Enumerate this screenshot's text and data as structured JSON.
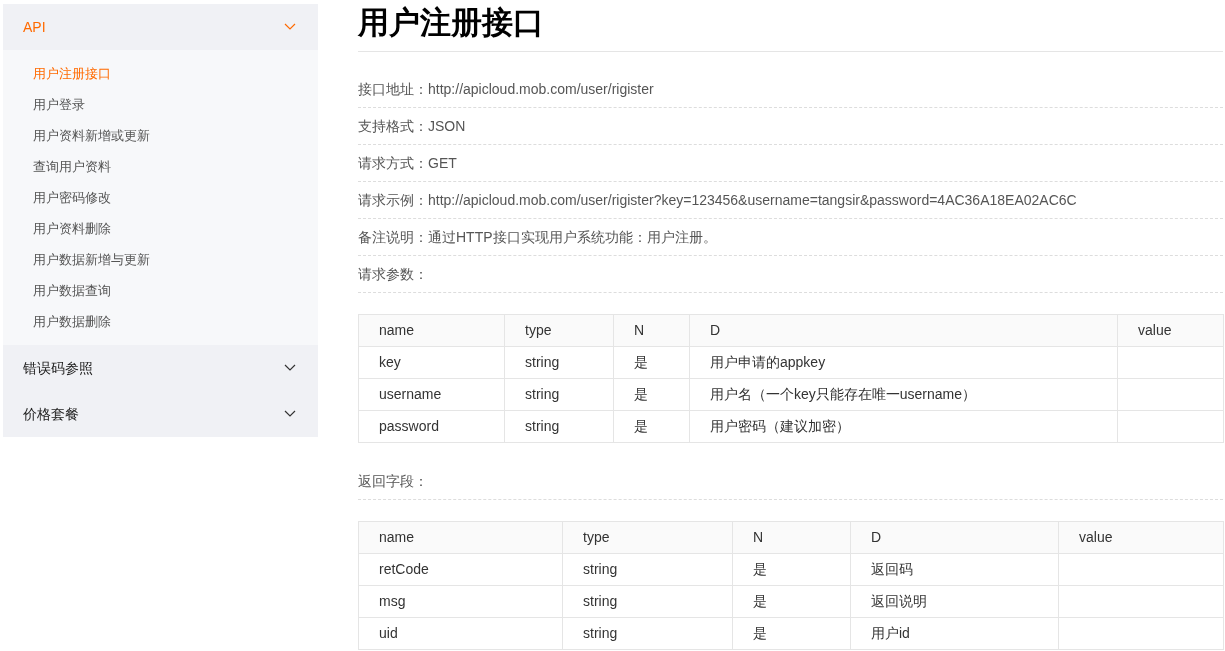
{
  "sidebar": {
    "sections": [
      {
        "label": "API",
        "expanded": true,
        "items": [
          {
            "label": "用户注册接口",
            "selected": true
          },
          {
            "label": "用户登录",
            "selected": false
          },
          {
            "label": "用户资料新增或更新",
            "selected": false
          },
          {
            "label": "查询用户资料",
            "selected": false
          },
          {
            "label": "用户密码修改",
            "selected": false
          },
          {
            "label": "用户资料删除",
            "selected": false
          },
          {
            "label": "用户数据新增与更新",
            "selected": false
          },
          {
            "label": "用户数据查询",
            "selected": false
          },
          {
            "label": "用户数据删除",
            "selected": false
          }
        ]
      },
      {
        "label": "错误码参照",
        "expanded": false
      },
      {
        "label": "价格套餐",
        "expanded": false
      }
    ]
  },
  "page": {
    "title": "用户注册接口",
    "info_lines": [
      "接口地址：http://apicloud.mob.com/user/rigister",
      "支持格式：JSON",
      "请求方式：GET",
      "请求示例：http://apicloud.mob.com/user/rigister?key=123456&username=tangsir&password=4AC36A18EA02AC6C",
      "备注说明：通过HTTP接口实现用户系统功能：用户注册。",
      "请求参数："
    ],
    "params_table": {
      "columns": [
        "name",
        "type",
        "N",
        "D",
        "value"
      ],
      "rows": [
        [
          "key",
          "string",
          "是",
          "用户申请的appkey"
        ],
        [
          "username",
          "string",
          "是",
          "用户名（一个key只能存在唯一username）"
        ],
        [
          "password",
          "string",
          "是",
          "用户密码（建议加密）"
        ]
      ]
    },
    "return_label": "返回字段：",
    "return_table": {
      "columns": [
        "name",
        "type",
        "N",
        "D",
        "value"
      ],
      "rows": [
        [
          "retCode",
          "string",
          "是",
          "返回码"
        ],
        [
          "msg",
          "string",
          "是",
          "返回说明"
        ],
        [
          "uid",
          "string",
          "是",
          "用户id"
        ]
      ]
    }
  }
}
